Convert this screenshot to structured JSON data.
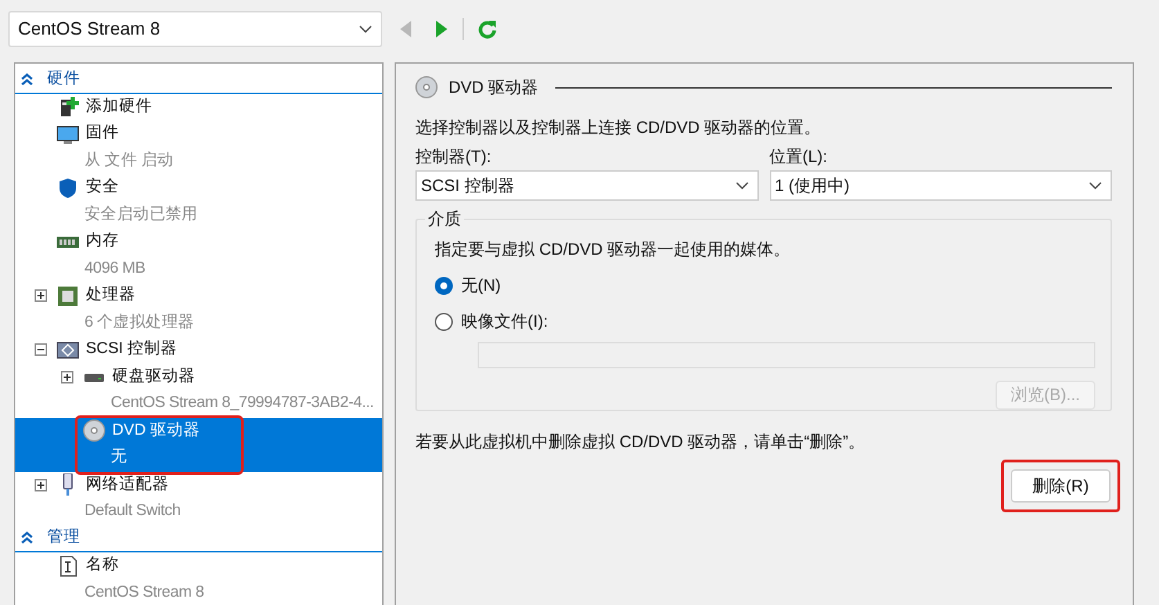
{
  "vm_selector": {
    "value": "CentOS Stream 8"
  },
  "toolbar": [
    {
      "kind": "back",
      "disabled": true
    },
    {
      "kind": "forward",
      "disabled": false
    },
    {
      "kind": "refresh",
      "disabled": false
    }
  ],
  "sections": [
    {
      "title": "硬件",
      "expanded": true,
      "items": [
        {
          "kind": "add-hardware",
          "label": "添加硬件",
          "selected": false
        },
        {
          "kind": "firmware",
          "label": "固件",
          "detail": "从 文件 启动",
          "selected": false
        },
        {
          "kind": "security",
          "label": "安全",
          "detail": "安全启动已禁用",
          "selected": false
        },
        {
          "kind": "memory",
          "label": "内存",
          "detail": "4096 MB",
          "selected": false
        },
        {
          "kind": "processor",
          "label": "处理器",
          "detail": "6 个虚拟处理器",
          "expanded": false,
          "selected": false
        },
        {
          "kind": "scsi",
          "label": "SCSI 控制器",
          "expanded": true,
          "selected": false,
          "children": [
            {
              "kind": "disk",
              "label": "硬盘驱动器",
              "detail": "CentOS Stream 8_79994787-3AB2-4...",
              "expanded": false,
              "selected": false
            },
            {
              "kind": "dvd",
              "label": "DVD 驱动器",
              "detail": "无",
              "selected": true,
              "highlighted": true
            }
          ]
        },
        {
          "kind": "network",
          "label": "网络适配器",
          "detail": "Default Switch",
          "expanded": false,
          "selected": false
        }
      ]
    },
    {
      "title": "管理",
      "expanded": true,
      "items": [
        {
          "kind": "name",
          "label": "名称",
          "detail": "CentOS Stream 8",
          "selected": false
        }
      ]
    }
  ],
  "detail": {
    "title": "DVD 驱动器",
    "description": "选择控制器以及控制器上连接 CD/DVD 驱动器的位置。",
    "controller": {
      "label": "控制器(T):",
      "value": "SCSI 控制器"
    },
    "location": {
      "label": "位置(L):",
      "value": "1 (使用中)"
    },
    "media": {
      "title": "介质",
      "description": "指定要与虚拟 CD/DVD 驱动器一起使用的媒体。",
      "options": [
        {
          "label": "无(N)",
          "selected": true
        },
        {
          "label": "映像文件(I):",
          "selected": false
        }
      ],
      "file_path": {
        "disabled": true
      },
      "browse_button": {
        "label": "浏览(B)...",
        "disabled": true
      }
    },
    "remove_hint": "若要从此虚拟机中删除虚拟 CD/DVD 驱动器，请单击“删除”。",
    "remove_button": {
      "label": "删除(R)",
      "highlighted": true
    }
  }
}
